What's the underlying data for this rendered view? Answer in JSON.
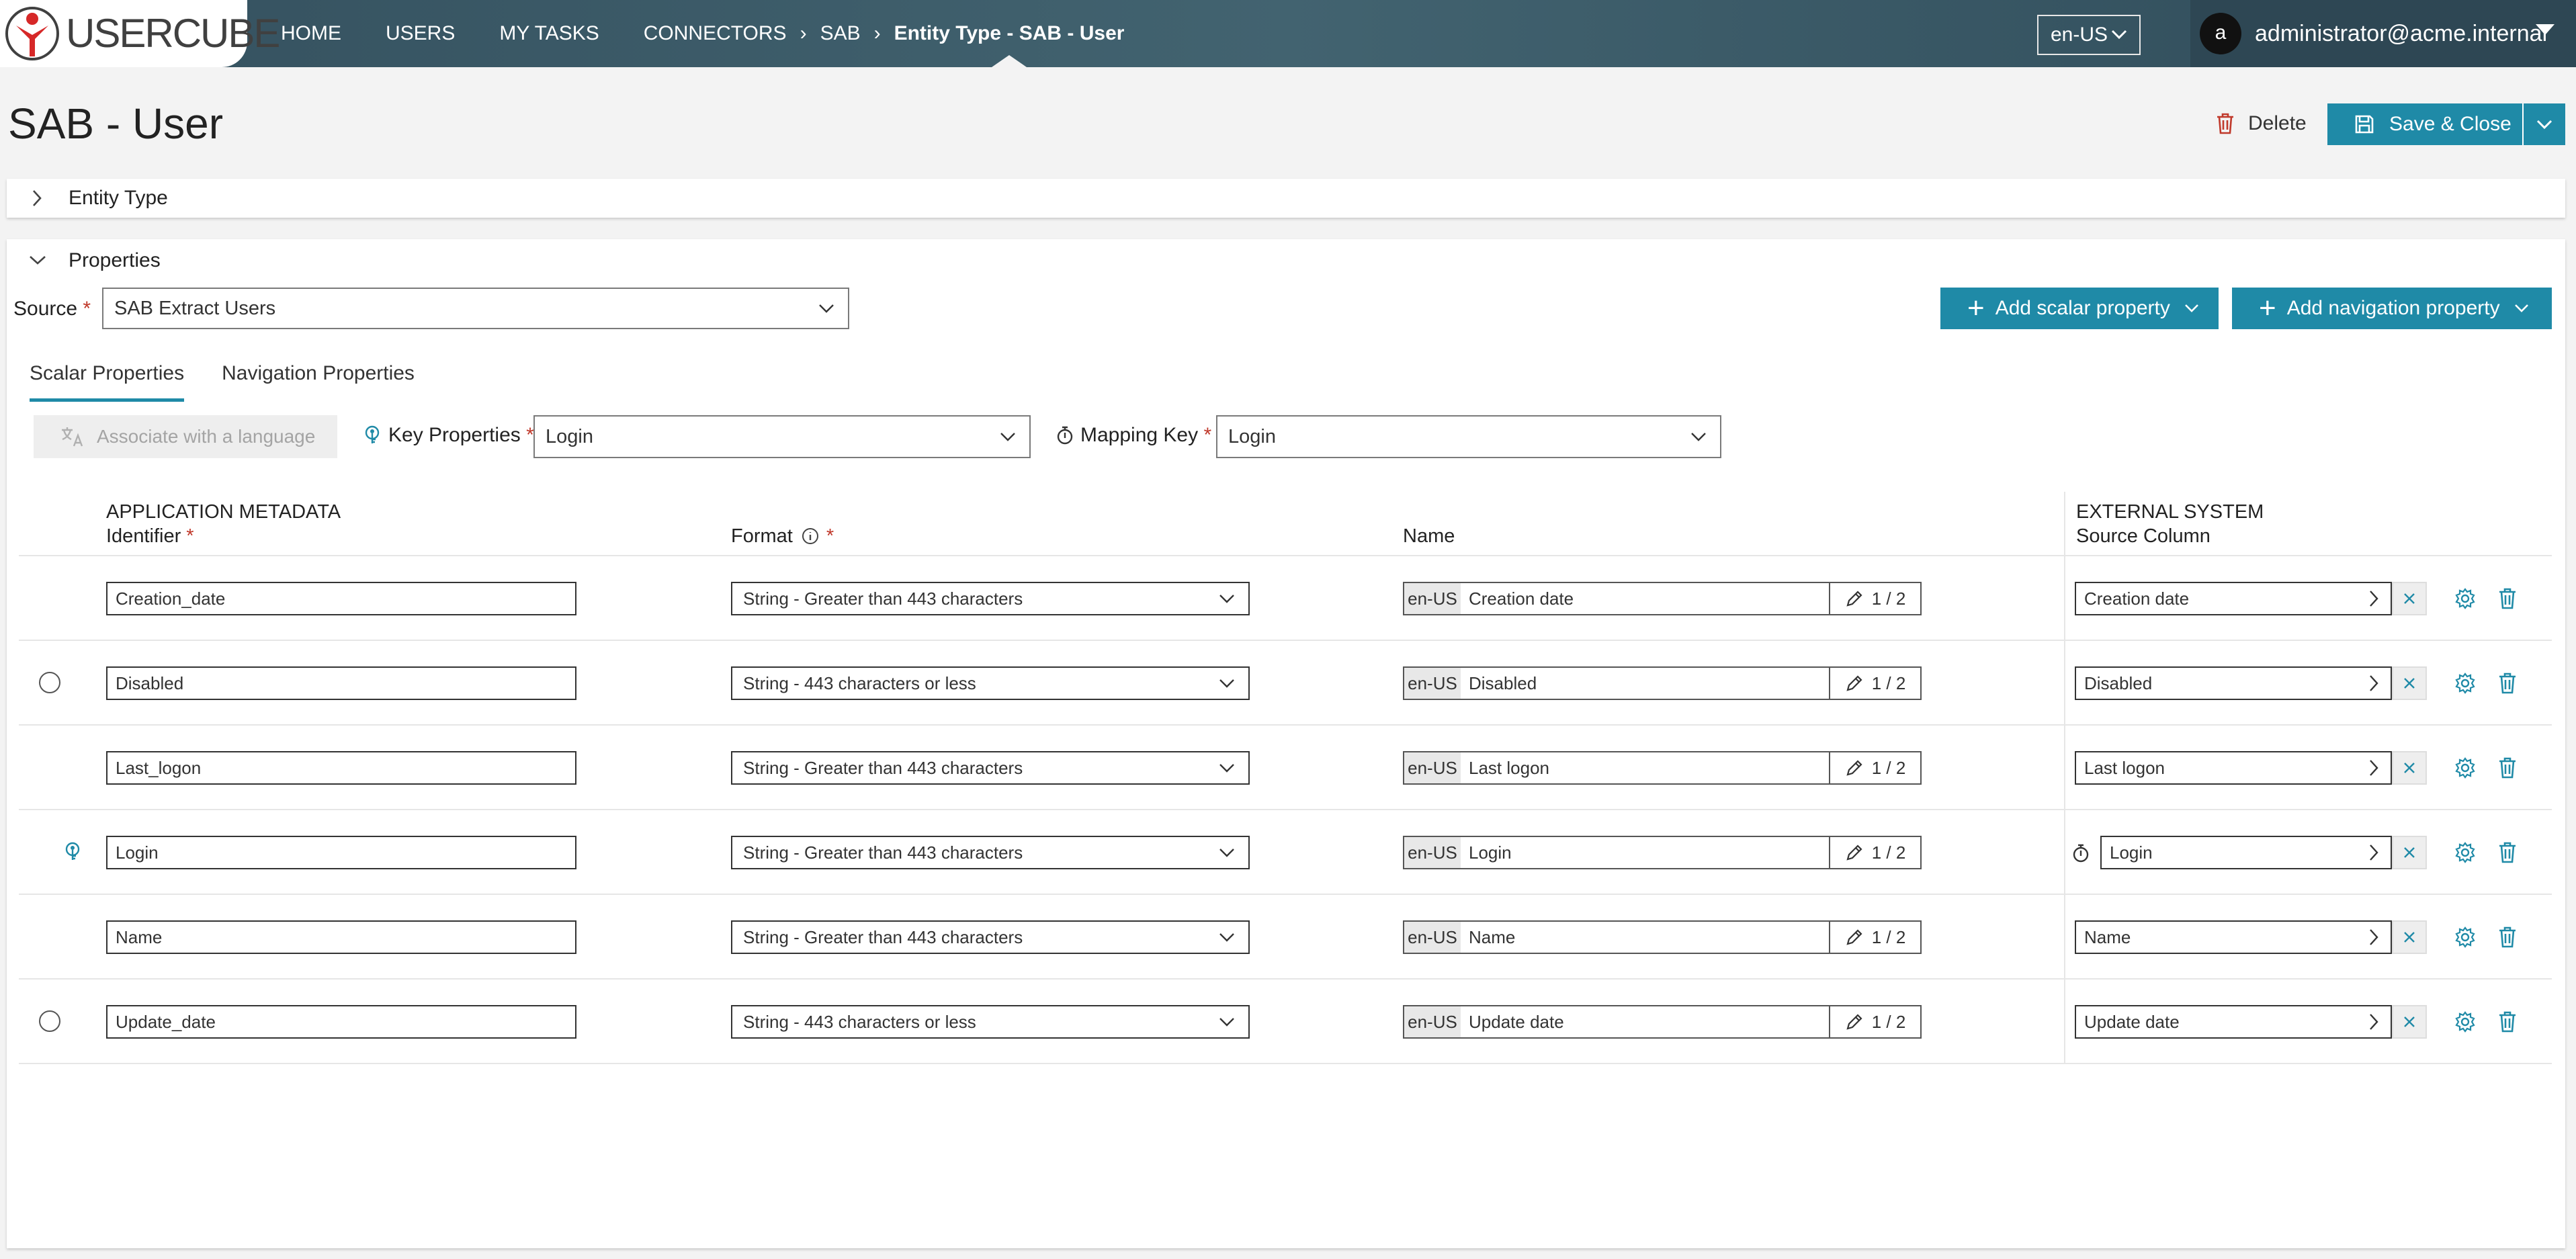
{
  "app": {
    "logo_text": "USERCUBE",
    "nav": [
      "HOME",
      "USERS",
      "MY TASKS"
    ],
    "breadcrumb": [
      "CONNECTORS",
      "SAB"
    ],
    "breadcrumb_current": "Entity Type - SAB - User",
    "language": "en-US",
    "user_initial": "a",
    "user_name": "administrator@acme.internal"
  },
  "page": {
    "title": "SAB - User",
    "delete_label": "Delete",
    "save_label": "Save & Close"
  },
  "panels": {
    "entity_type": "Entity Type",
    "properties": "Properties"
  },
  "properties": {
    "source_label": "Source",
    "source_value": "SAB Extract Users",
    "add_scalar_label": "Add scalar property",
    "add_navigation_label": "Add navigation property",
    "tabs": [
      "Scalar Properties",
      "Navigation Properties"
    ],
    "associate_label": "Associate with a language",
    "key_properties_label": "Key Properties",
    "key_properties_value": "Login",
    "mapping_key_label": "Mapping Key",
    "mapping_key_value": "Login",
    "columns": {
      "app_metadata": "APPLICATION METADATA",
      "identifier": "Identifier",
      "format": "Format",
      "name": "Name",
      "external_system": "EXTERNAL SYSTEM",
      "source_column": "Source Column"
    },
    "rows": [
      {
        "indicator": "none",
        "identifier": "Creation_date",
        "format": "String - Greater than 443 characters",
        "name_lang": "en-US",
        "name": "Creation date",
        "name_count": "1 / 2",
        "source_column": "Creation date",
        "mapping_key": false
      },
      {
        "indicator": "radio",
        "identifier": "Disabled",
        "format": "String - 443 characters or less",
        "name_lang": "en-US",
        "name": "Disabled",
        "name_count": "1 / 2",
        "source_column": "Disabled",
        "mapping_key": false
      },
      {
        "indicator": "none",
        "identifier": "Last_logon",
        "format": "String - Greater than 443 characters",
        "name_lang": "en-US",
        "name": "Last logon",
        "name_count": "1 / 2",
        "source_column": "Last logon",
        "mapping_key": false
      },
      {
        "indicator": "key",
        "identifier": "Login",
        "format": "String - Greater than 443 characters",
        "name_lang": "en-US",
        "name": "Login",
        "name_count": "1 / 2",
        "source_column": "Login",
        "mapping_key": true
      },
      {
        "indicator": "none",
        "identifier": "Name",
        "format": "String - Greater than 443 characters",
        "name_lang": "en-US",
        "name": "Name",
        "name_count": "1 / 2",
        "source_column": "Name",
        "mapping_key": false
      },
      {
        "indicator": "radio",
        "identifier": "Update_date",
        "format": "String - 443 characters or less",
        "name_lang": "en-US",
        "name": "Update date",
        "name_count": "1 / 2",
        "source_column": "Update date",
        "mapping_key": false
      }
    ]
  },
  "colors": {
    "accent": "#1f8aa7",
    "topbar": "#3a5866",
    "required": "#c0392b",
    "delete_icon": "#c0392b"
  },
  "icons": [
    "usercube-logo-icon",
    "chevron-right-icon",
    "chevron-down-icon",
    "trash-icon",
    "save-icon",
    "plus-icon",
    "key-icon",
    "mapping-key-icon",
    "info-icon",
    "pencil-icon",
    "close-icon",
    "gear-icon",
    "language-icon"
  ]
}
